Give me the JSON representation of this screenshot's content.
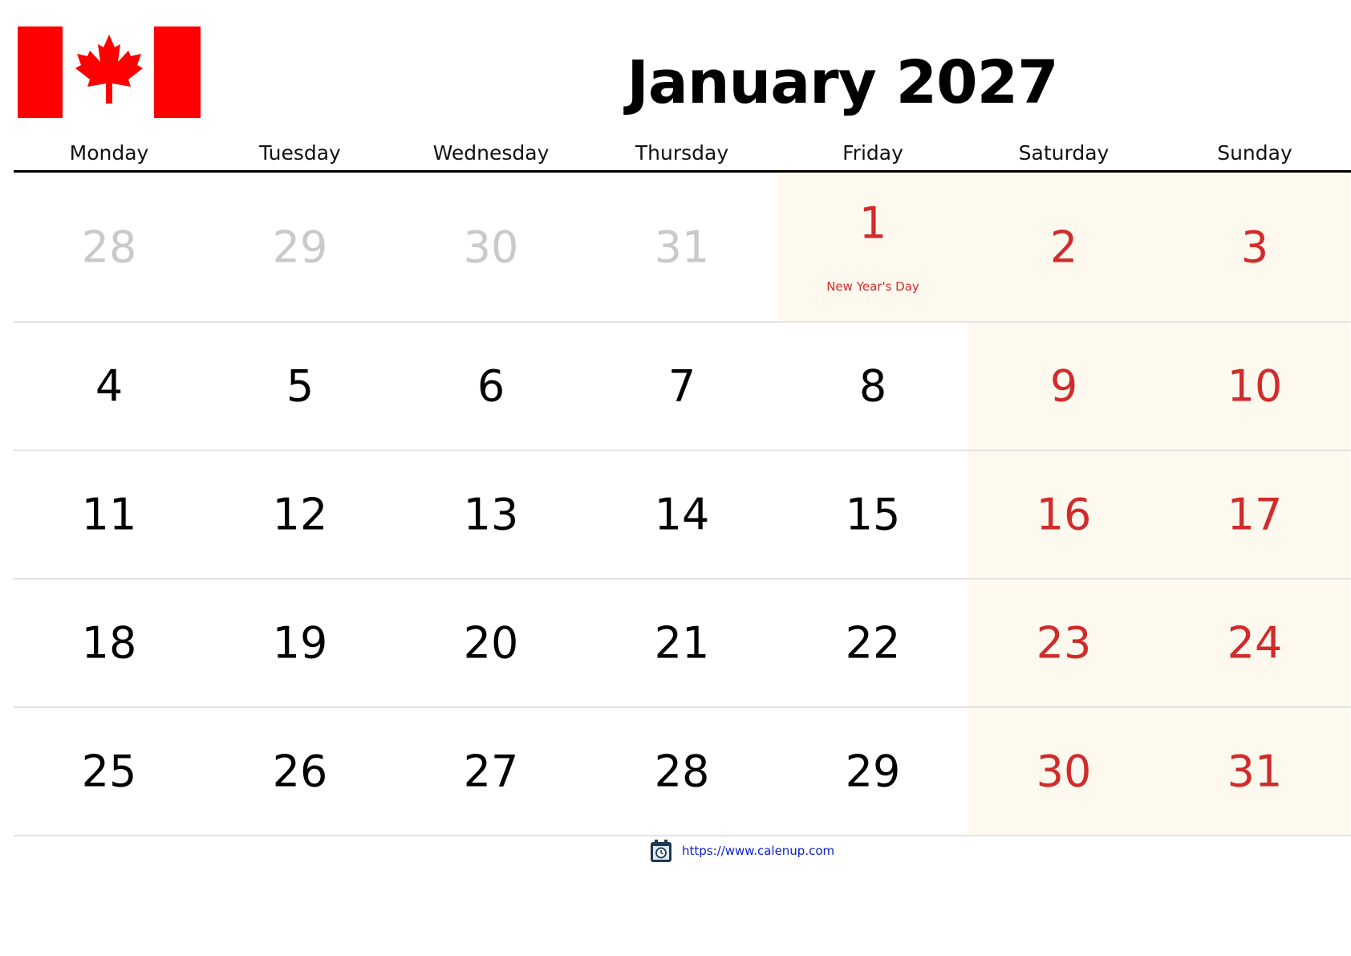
{
  "header": {
    "title": "January 2027",
    "flag_icon": "canada-flag-icon"
  },
  "weekdays": [
    "Monday",
    "Tuesday",
    "Wednesday",
    "Thursday",
    "Friday",
    "Saturday",
    "Sunday"
  ],
  "colors": {
    "holiday_red": "#d12b2b",
    "weekend_bg": "#fef9ee",
    "other_month_gray": "#c9c9c9",
    "link_blue": "#0a1fc7",
    "flag_red": "#ff0000"
  },
  "weeks": [
    [
      {
        "day": "28",
        "type": "other"
      },
      {
        "day": "29",
        "type": "other"
      },
      {
        "day": "30",
        "type": "other"
      },
      {
        "day": "31",
        "type": "other"
      },
      {
        "day": "1",
        "type": "holiday",
        "holiday": "New Year's Day"
      },
      {
        "day": "2",
        "type": "weekend"
      },
      {
        "day": "3",
        "type": "weekend"
      }
    ],
    [
      {
        "day": "4",
        "type": "normal"
      },
      {
        "day": "5",
        "type": "normal"
      },
      {
        "day": "6",
        "type": "normal"
      },
      {
        "day": "7",
        "type": "normal"
      },
      {
        "day": "8",
        "type": "normal"
      },
      {
        "day": "9",
        "type": "weekend"
      },
      {
        "day": "10",
        "type": "weekend"
      }
    ],
    [
      {
        "day": "11",
        "type": "normal"
      },
      {
        "day": "12",
        "type": "normal"
      },
      {
        "day": "13",
        "type": "normal"
      },
      {
        "day": "14",
        "type": "normal"
      },
      {
        "day": "15",
        "type": "normal"
      },
      {
        "day": "16",
        "type": "weekend"
      },
      {
        "day": "17",
        "type": "weekend"
      }
    ],
    [
      {
        "day": "18",
        "type": "normal"
      },
      {
        "day": "19",
        "type": "normal"
      },
      {
        "day": "20",
        "type": "normal"
      },
      {
        "day": "21",
        "type": "normal"
      },
      {
        "day": "22",
        "type": "normal"
      },
      {
        "day": "23",
        "type": "weekend"
      },
      {
        "day": "24",
        "type": "weekend"
      }
    ],
    [
      {
        "day": "25",
        "type": "normal"
      },
      {
        "day": "26",
        "type": "normal"
      },
      {
        "day": "27",
        "type": "normal"
      },
      {
        "day": "28",
        "type": "normal"
      },
      {
        "day": "29",
        "type": "normal"
      },
      {
        "day": "30",
        "type": "weekend"
      },
      {
        "day": "31",
        "type": "weekend"
      }
    ]
  ],
  "footer": {
    "icon": "calendar-clock-icon",
    "link_text": "https://www.calenup.com"
  }
}
